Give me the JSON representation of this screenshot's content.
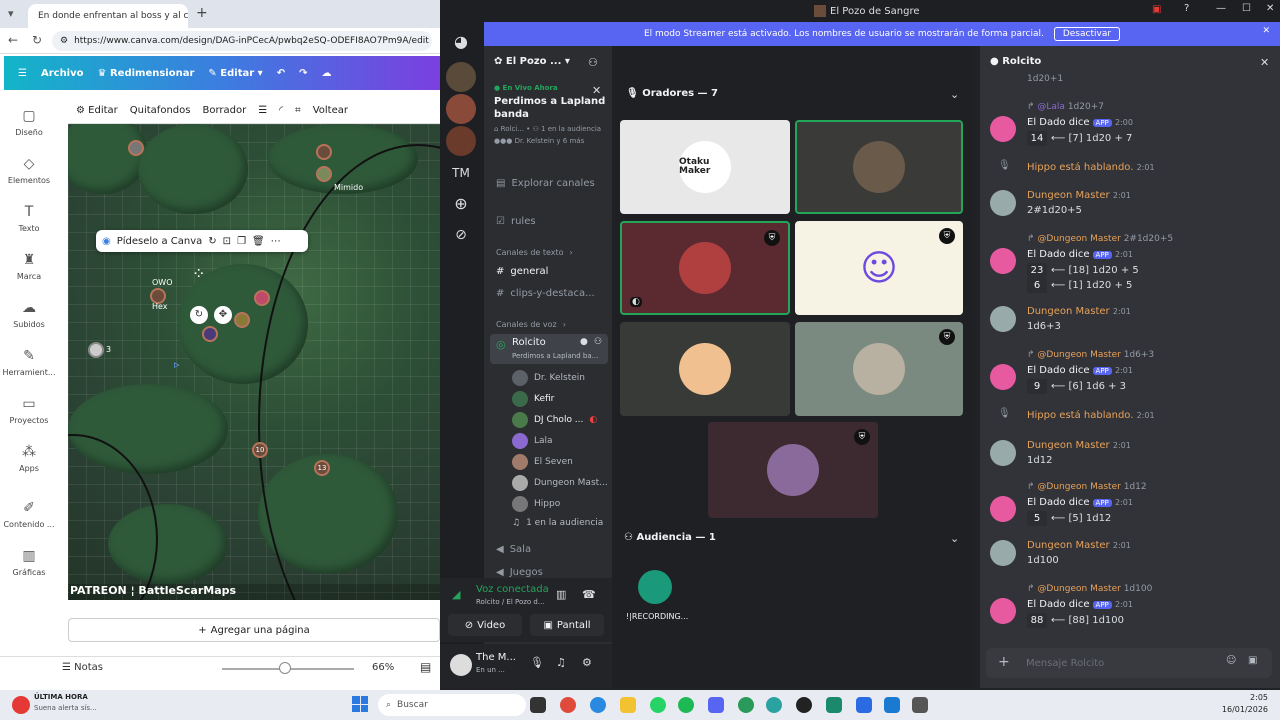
{
  "browser": {
    "tab_title": "En donde enfrentan al boss y al c",
    "url": "https://www.canva.com/design/DAG-inPCecA/pwbq2eSQ-ODEFI8AO7Pm9A/edit",
    "canva_menu": [
      "Archivo",
      "Redimensionar",
      "Editar"
    ],
    "rail": [
      "Diseño",
      "Elementos",
      "Texto",
      "Marca",
      "Subidos",
      "Herramient...",
      "Proyectos",
      "Apps",
      "Contenido ...",
      "Gráficas"
    ],
    "toolbar": [
      "Editar",
      "Quitafondos",
      "Borrador",
      "Voltear"
    ],
    "popup_label": "Pídeselo a Canva",
    "map_labels": {
      "mimido": "Mimido",
      "owo": "OWO",
      "hex": "Hex",
      "n10": "10",
      "n13": "13",
      "n3": "3"
    },
    "map_footer": "PATREON ¦ BattleScarMaps",
    "add_page": "Agregar una página",
    "notes": "Notas",
    "zoom": "66%",
    "zoom_slider_fraction": 0.48
  },
  "discord": {
    "window_title": "El Pozo de Sangre",
    "streamer_notice": "El modo Streamer está activado. Los nombres de usuario se mostrarán de forma parcial.",
    "streamer_button": "Desactivar",
    "server_name": "El Pozo ...",
    "server_tm": "TM",
    "live": {
      "badge": "En Vivo Ahora",
      "title": "Perdimos a Lapland banda",
      "channel": "Rolci...",
      "audience": "1 en la audiencia",
      "members": "Dr. Kelstein y 6 más"
    },
    "explore": "Explorar canales",
    "rules": "rules",
    "text_header": "Canales de texto",
    "text_channels": [
      "general",
      "clips-y-destaca..."
    ],
    "voice_header": "Canales de voz",
    "voice_channel": {
      "name": "Rolcito",
      "subtitle": "Perdimos a Lapland ba..."
    },
    "voice_users": [
      "Dr. Kelstein",
      "Kefir",
      "DJ Cholo ...",
      "Lala",
      "El Seven",
      "Dungeon Mast...",
      "Hippo",
      "1 en la audiencia"
    ],
    "other_channels": [
      "Sala",
      "Juegos"
    ],
    "voice_status": {
      "title": "Voz conectada",
      "subtitle": "Rolcito / El Pozo d...",
      "video": "Video",
      "screen": "Pantall"
    },
    "user": {
      "name": "The M...",
      "status": "En un ..."
    },
    "stage": {
      "speakers_header": "Oradores — 7",
      "audience_header": "Audiencia — 1",
      "otaku_text": "Otaku Maker",
      "audience_name": "!|RECORDING..."
    },
    "chat": {
      "channel": "Rolcito",
      "top_fragment": "1d20+1",
      "messages": [
        {
          "ref_user": "@Lala",
          "ref_cmd": "1d20+7",
          "name": "El Dado dice",
          "tag": "APP",
          "time": "2:00",
          "result": "14",
          "text": "⟵ [7] 1d20 + 7"
        },
        {
          "system": "Hippo está hablando.",
          "time": "2:01"
        },
        {
          "name": "Dungeon Master",
          "time": "2:01",
          "text": "2#1d20+5"
        },
        {
          "ref_user": "@Dungeon Master",
          "ref_cmd": "2#1d20+5",
          "name": "El Dado dice",
          "tag": "APP",
          "time": "2:01",
          "result": "23",
          "text": "⟵ [18] 1d20 + 5",
          "result2": "6",
          "text2": "⟵ [1] 1d20 + 5"
        },
        {
          "name": "Dungeon Master",
          "time": "2:01",
          "text": "1d6+3"
        },
        {
          "ref_user": "@Dungeon Master",
          "ref_cmd": "1d6+3",
          "name": "El Dado dice",
          "tag": "APP",
          "time": "2:01",
          "result": "9",
          "text": "⟵ [6] 1d6 + 3"
        },
        {
          "system": "Hippo está hablando.",
          "time": "2:01"
        },
        {
          "name": "Dungeon Master",
          "time": "2:01",
          "text": "1d12"
        },
        {
          "ref_user": "@Dungeon Master",
          "ref_cmd": "1d12",
          "name": "El Dado dice",
          "tag": "APP",
          "time": "2:01",
          "result": "5",
          "text": "⟵ [5] 1d12"
        },
        {
          "name": "Dungeon Master",
          "time": "2:01",
          "text": "1d100"
        },
        {
          "ref_user": "@Dungeon Master",
          "ref_cmd": "1d100",
          "name": "El Dado dice",
          "tag": "APP",
          "time": "2:01",
          "result": "88",
          "text": "⟵ [88] 1d100"
        }
      ],
      "placeholder": "Mensaje Rolcito"
    }
  },
  "taskbar": {
    "news_title": "ÚLTIMA HORA",
    "news_sub": "Suena alerta sís...",
    "search": "Buscar",
    "time": "2:05",
    "date": "16/01/2026"
  },
  "colors": {
    "blurple": "#5865f2",
    "dm_name": "#e8a25a",
    "green": "#23a55a"
  }
}
